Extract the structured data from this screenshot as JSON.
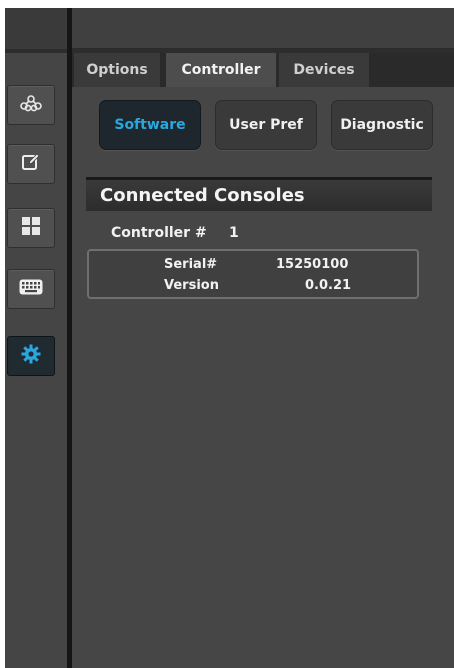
{
  "tabs": [
    {
      "label": "Options",
      "active": false
    },
    {
      "label": "Controller",
      "active": true
    },
    {
      "label": "Devices",
      "active": false
    }
  ],
  "subtabs": [
    {
      "label": "Software",
      "active": true
    },
    {
      "label": "User Pref",
      "active": false
    },
    {
      "label": "Diagnostic",
      "active": false
    }
  ],
  "sidebar": {
    "items": [
      {
        "icon": "network-icon",
        "active": false
      },
      {
        "icon": "edit-icon",
        "active": false
      },
      {
        "icon": "grid-icon",
        "active": false
      },
      {
        "icon": "keyboard-icon",
        "active": false
      },
      {
        "icon": "gear-icon",
        "active": true
      }
    ]
  },
  "section": {
    "title": "Connected Consoles",
    "controller_label": "Controller #",
    "controller_value": "1",
    "serial_label": "Serial#",
    "serial_value": "15250100",
    "version_label": "Version",
    "version_value": "0.0.21"
  },
  "colors": {
    "accent": "#29a8e0",
    "panel": "#464646"
  }
}
